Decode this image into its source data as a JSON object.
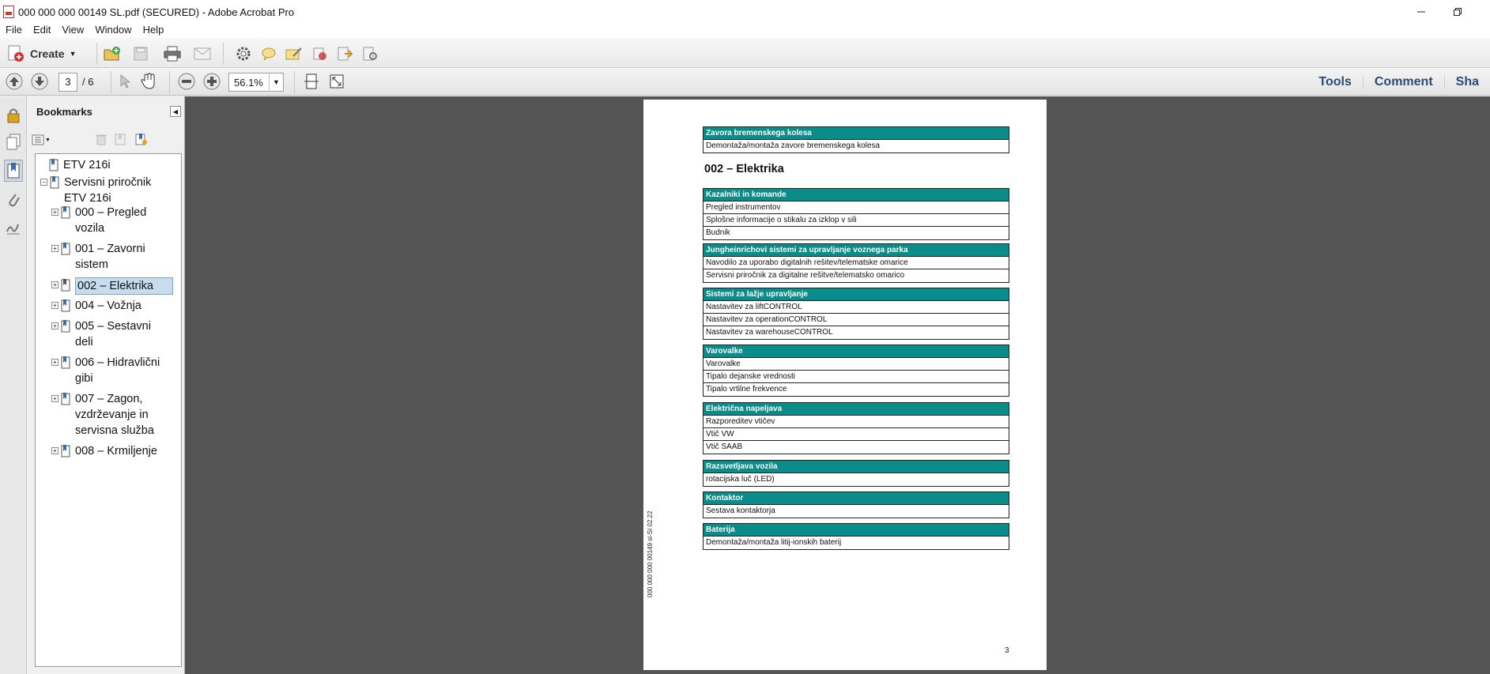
{
  "window": {
    "title": "000 000 000 00149 SL.pdf (SECURED) - Adobe Acrobat Pro"
  },
  "menu": [
    "File",
    "Edit",
    "View",
    "Window",
    "Help"
  ],
  "toolbar": {
    "create_label": "Create"
  },
  "nav": {
    "current_page": "3",
    "page_sep": "/ 6",
    "zoom": "56.1%"
  },
  "right_links": [
    "Tools",
    "Comment",
    "Sha"
  ],
  "bookmarks": {
    "title": "Bookmarks",
    "items": [
      {
        "label": "ETV 216i"
      },
      {
        "label": "Servisni priročnik ETV 216i"
      },
      {
        "label": "000 – Pregled vozila"
      },
      {
        "label": "001 – Zavorni sistem"
      },
      {
        "label": "002 – Elektrika"
      },
      {
        "label": "004 – Vožnja"
      },
      {
        "label": "005 – Sestavni deli"
      },
      {
        "label": "006 – Hidravlični gibi"
      },
      {
        "label": "007 – Zagon, vzdrževanje in servisna služba"
      },
      {
        "label": "008 – Krmiljenje"
      }
    ]
  },
  "document": {
    "heading": "002 – Elektrika",
    "side_code": "000 000 000 00149 sl-SI 02.22",
    "page_number": "3",
    "blocks": [
      {
        "title": "Zavora bremenskega kolesa",
        "rows": [
          "Demontaža/montaža zavore bremenskega kolesa"
        ]
      },
      {
        "title": "Kazalniki in komande",
        "rows": [
          "Pregled instrumentov",
          "Splošne informacije o stikalu za izklop v sili",
          "Budnik"
        ]
      },
      {
        "title": "Jungheinrichovi sistemi za upravljanje voznega parka",
        "rows": [
          "Navodilo za uporabo digitalnih rešitev/telematske omarice",
          "Servisni priročnik za digitalne rešitve/telematsko omarico"
        ]
      },
      {
        "title": "Sistemi za lažje upravljanje",
        "rows": [
          "Nastavitev za liftCONTROL",
          "Nastavitev za operationCONTROL",
          "Nastavitev za warehouseCONTROL"
        ]
      },
      {
        "title": "Varovalke",
        "rows": [
          "Varovalke",
          "Tipalo dejanske vrednosti",
          "Tipalo vrtilne frekvence"
        ]
      },
      {
        "title": "Električna napeljava",
        "rows": [
          "Razporeditev vtičev",
          "Vtič VW",
          "Vtič SAAB"
        ]
      },
      {
        "title": "Razsvetljava vozila",
        "rows": [
          "rotacijska luč (LED)"
        ]
      },
      {
        "title": "Kontaktor",
        "rows": [
          "Sestava kontaktorja"
        ]
      },
      {
        "title": "Baterija",
        "rows": [
          "Demontaža/montaža litij-ionskih baterij"
        ]
      }
    ]
  }
}
